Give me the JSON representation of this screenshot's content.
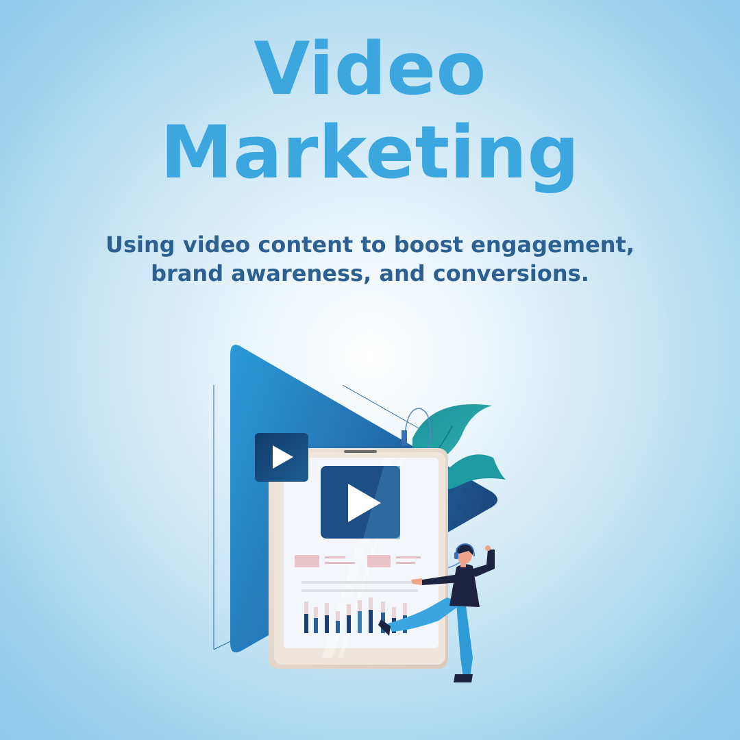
{
  "title": {
    "line1": "Video",
    "line2": "Marketing"
  },
  "subtitle": {
    "line1": "Using video content to boost engagement,",
    "line2": "brand awareness, and conversions."
  },
  "colors": {
    "title": "#3ba7de",
    "subtitle": "#2e5f91",
    "play_triangle_light": "#2a9ad8",
    "play_triangle_dark": "#1e4f86",
    "leaf": "#1f9aa0",
    "tablet_frame": "#e9ddd3",
    "tablet_screen": "#f2f6fb",
    "play_box": "#1d4f86",
    "person_shirt": "#1b2340",
    "person_pants": "#2e9ad8"
  },
  "illustration": {
    "icons": [
      "large-play-triangle-icon",
      "small-play-button-icon",
      "tablet-play-button-icon",
      "leaf-icon",
      "bar-chart-icon",
      "dancing-person-figure"
    ]
  }
}
